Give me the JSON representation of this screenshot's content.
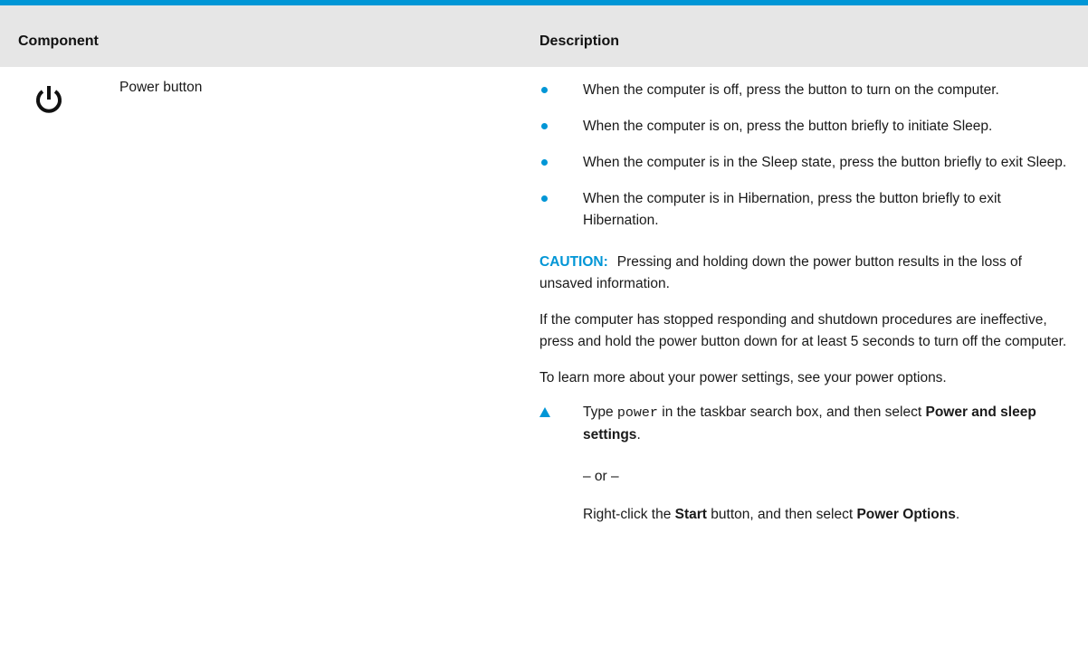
{
  "table": {
    "header": {
      "component": "Component",
      "description": "Description"
    },
    "row": {
      "icon": "power-icon",
      "component_name": "Power button",
      "bullets": [
        "When the computer is off, press the button to turn on the computer.",
        "When the computer is on, press the button briefly to initiate Sleep.",
        "When the computer is in the Sleep state, press the button briefly to exit Sleep.",
        "When the computer is in Hibernation, press the button briefly to exit Hibernation."
      ],
      "caution_label": "CAUTION:",
      "caution_text": "Pressing and holding down the power button results in the loss of unsaved information.",
      "paragraph_unresponsive": "If the computer has stopped responding and shutdown procedures are ineffective, press and hold the power button down for at least 5 seconds to turn off the computer.",
      "paragraph_learn_more": "To learn more about your power settings, see your power options.",
      "step": {
        "prefix": "Type ",
        "code": "power",
        "middle": " in the taskbar search box, and then select ",
        "bold": "Power and sleep settings",
        "suffix": "."
      },
      "or_text": "– or –",
      "alt": {
        "prefix": "Right-click the ",
        "bold1": "Start",
        "middle": " button, and then select ",
        "bold2": "Power Options",
        "suffix": "."
      }
    }
  },
  "colors": {
    "accent": "#0096d6",
    "header_bg": "#e6e6e6",
    "text": "#1a1a1a"
  }
}
